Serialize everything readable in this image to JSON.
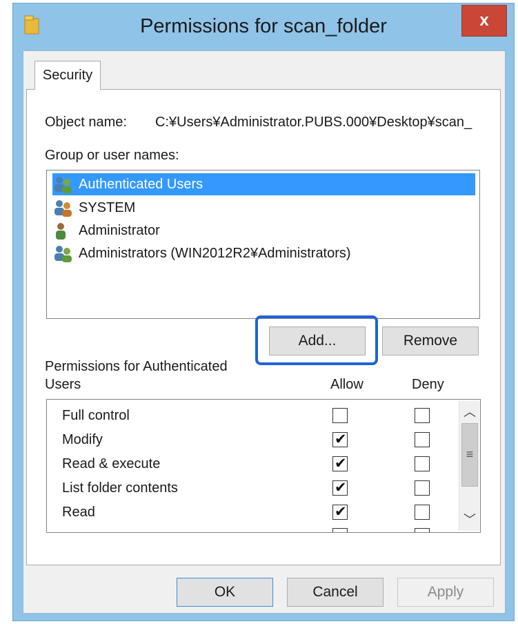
{
  "window": {
    "title": "Permissions for scan_folder",
    "close_label": "x",
    "title_bar_color": "#8fc3e8",
    "close_color": "#c84736"
  },
  "tabs": [
    {
      "label": "Security",
      "selected": true
    }
  ],
  "object_name": {
    "label": "Object name:",
    "value": "C:¥Users¥Administrator.PUBS.000¥Desktop¥scan_"
  },
  "group_list": {
    "label": "Group or user names:",
    "items": [
      {
        "label": "Authenticated Users",
        "icon": "users-group-icon",
        "selected": true
      },
      {
        "label": "SYSTEM",
        "icon": "users-group-icon",
        "selected": false
      },
      {
        "label": "Administrator",
        "icon": "user-icon",
        "selected": false
      },
      {
        "label": "Administrators (WIN2012R2¥Administrators)",
        "icon": "users-group-icon",
        "selected": false
      }
    ],
    "selection_color": "#3399ff"
  },
  "buttons": {
    "add": "Add...",
    "remove": "Remove",
    "ok": "OK",
    "cancel": "Cancel",
    "apply": "Apply"
  },
  "permissions": {
    "label_line1": "Permissions for Authenticated",
    "label_line2": "Users",
    "allow_header": "Allow",
    "deny_header": "Deny",
    "rows": [
      {
        "label": "Full control",
        "allow": false,
        "deny": false
      },
      {
        "label": "Modify",
        "allow": true,
        "deny": false
      },
      {
        "label": "Read & execute",
        "allow": true,
        "deny": false
      },
      {
        "label": "List folder contents",
        "allow": true,
        "deny": false
      },
      {
        "label": "Read",
        "allow": true,
        "deny": false
      }
    ]
  },
  "highlight_color": "#1f63d7"
}
